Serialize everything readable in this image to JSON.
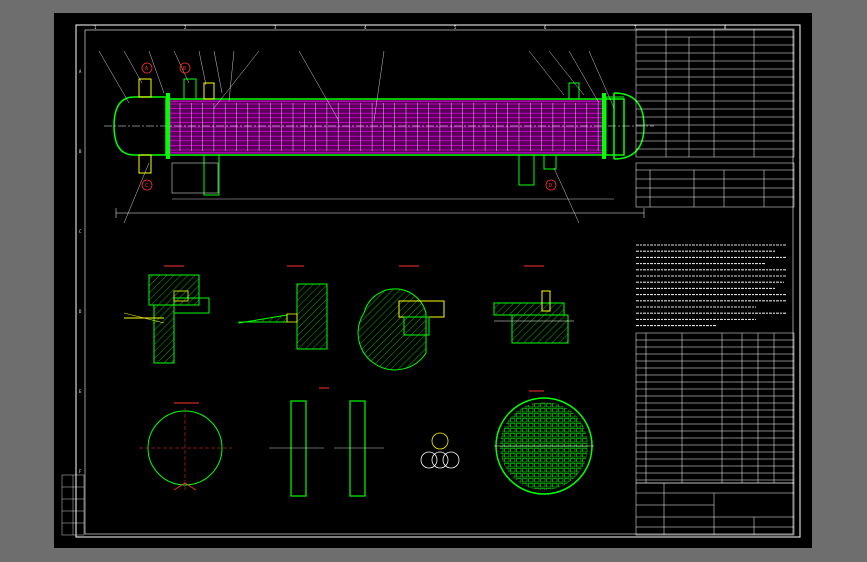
{
  "colors": {
    "background": "#000000",
    "frame": "#ffffff",
    "equipment": "#00ff00",
    "tubes": "#ff00ff",
    "section_marks": "#ff3030",
    "pipes": "#ffff00",
    "hatch": "#00ffff"
  },
  "border": {
    "col_marks": [
      "1",
      "2",
      "3",
      "4",
      "5",
      "6",
      "7",
      "8"
    ],
    "row_marks": [
      "A",
      "B",
      "C",
      "D",
      "E",
      "F"
    ]
  },
  "view_marks": {
    "a": "A",
    "b": "B",
    "c": "C",
    "d": "D"
  },
  "drawing": {
    "title": "",
    "scale": "",
    "number": ""
  }
}
